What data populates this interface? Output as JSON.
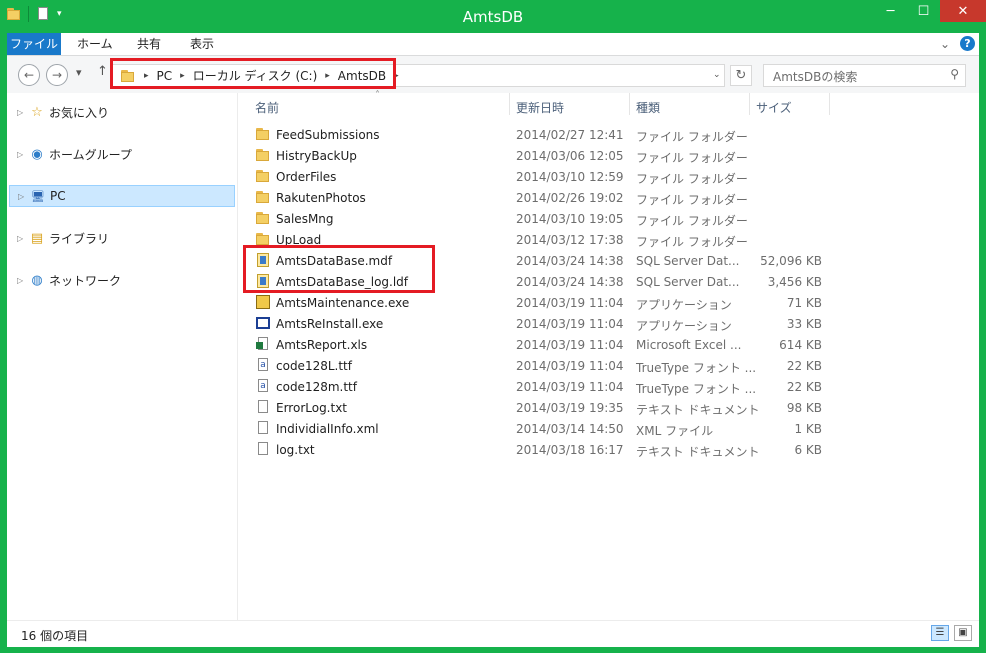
{
  "window": {
    "title": "AmtsDB",
    "minimize_glyph": "─",
    "maximize_glyph": "☐",
    "close_glyph": "✕"
  },
  "ribbon": {
    "tabs": [
      "ファイル",
      "ホーム",
      "共有",
      "表示"
    ],
    "collapse_glyph": "⌄",
    "help_glyph": "?"
  },
  "navigation": {
    "back_glyph": "←",
    "forward_glyph": "→",
    "recent_glyph": "▾",
    "up_glyph": "↑",
    "breadcrumb": [
      "PC",
      "ローカル ディスク (C:)",
      "AmtsDB"
    ],
    "crumb_separator": "▸",
    "dropdown_glyph": "⌄",
    "refresh_glyph": "↻",
    "search_placeholder": "AmtsDBの検索",
    "search_glyph": "⚲"
  },
  "sidebar": {
    "items": [
      {
        "label": "お気に入り",
        "icon": "star-icon",
        "glyph": "☆"
      },
      {
        "label": "ホームグループ",
        "icon": "homegroup-icon",
        "glyph": "◉"
      },
      {
        "label": "PC",
        "icon": "pc-icon",
        "glyph": "🖥",
        "selected": true
      },
      {
        "label": "ライブラリ",
        "icon": "library-icon",
        "glyph": "▤"
      },
      {
        "label": "ネットワーク",
        "icon": "network-icon",
        "glyph": "◍"
      }
    ],
    "expand_glyph": "▷"
  },
  "columns": {
    "name": "名前",
    "date": "更新日時",
    "type": "種類",
    "size": "サイズ",
    "sort_glyph": "˄"
  },
  "files": [
    {
      "name": "FeedSubmissions",
      "date": "2014/02/27 12:41",
      "type": "ファイル フォルダー",
      "size": "",
      "icon": "folder-icon"
    },
    {
      "name": "HistryBackUp",
      "date": "2014/03/06 12:05",
      "type": "ファイル フォルダー",
      "size": "",
      "icon": "folder-icon"
    },
    {
      "name": "OrderFiles",
      "date": "2014/03/10 12:59",
      "type": "ファイル フォルダー",
      "size": "",
      "icon": "folder-icon"
    },
    {
      "name": "RakutenPhotos",
      "date": "2014/02/26 19:02",
      "type": "ファイル フォルダー",
      "size": "",
      "icon": "folder-icon"
    },
    {
      "name": "SalesMng",
      "date": "2014/03/10 19:05",
      "type": "ファイル フォルダー",
      "size": "",
      "icon": "folder-icon"
    },
    {
      "name": "UpLoad",
      "date": "2014/03/12 17:38",
      "type": "ファイル フォルダー",
      "size": "",
      "icon": "folder-icon"
    },
    {
      "name": "AmtsDataBase.mdf",
      "date": "2014/03/24 14:38",
      "type": "SQL Server Dat...",
      "size": "52,096 KB",
      "icon": "database-icon"
    },
    {
      "name": "AmtsDataBase_log.ldf",
      "date": "2014/03/24 14:38",
      "type": "SQL Server Dat...",
      "size": "3,456 KB",
      "icon": "database-icon"
    },
    {
      "name": "AmtsMaintenance.exe",
      "date": "2014/03/19 11:04",
      "type": "アプリケーション",
      "size": "71 KB",
      "icon": "maintenance-app-icon"
    },
    {
      "name": "AmtsReInstall.exe",
      "date": "2014/03/19 11:04",
      "type": "アプリケーション",
      "size": "33 KB",
      "icon": "application-icon"
    },
    {
      "name": "AmtsReport.xls",
      "date": "2014/03/19 11:04",
      "type": "Microsoft Excel ...",
      "size": "614 KB",
      "icon": "excel-icon"
    },
    {
      "name": "code128L.ttf",
      "date": "2014/03/19 11:04",
      "type": "TrueType フォント ...",
      "size": "22 KB",
      "icon": "font-icon"
    },
    {
      "name": "code128m.ttf",
      "date": "2014/03/19 11:04",
      "type": "TrueType フォント ...",
      "size": "22 KB",
      "icon": "font-icon"
    },
    {
      "name": "ErrorLog.txt",
      "date": "2014/03/19 19:35",
      "type": "テキスト ドキュメント",
      "size": "98 KB",
      "icon": "text-file-icon"
    },
    {
      "name": "IndividialInfo.xml",
      "date": "2014/03/14 14:50",
      "type": "XML ファイル",
      "size": "1 KB",
      "icon": "text-file-icon"
    },
    {
      "name": "log.txt",
      "date": "2014/03/18 16:17",
      "type": "テキスト ドキュメント",
      "size": "6 KB",
      "icon": "text-file-icon"
    }
  ],
  "status": {
    "item_count": "16 個の項目",
    "details_view_glyph": "☰",
    "large_icons_view_glyph": "▣"
  },
  "colors": {
    "window_frame": "#16b24b",
    "file_tab": "#1979ca",
    "close_button": "#c7382c",
    "highlight_box": "#e41b23",
    "selection": "#cce8ff"
  }
}
